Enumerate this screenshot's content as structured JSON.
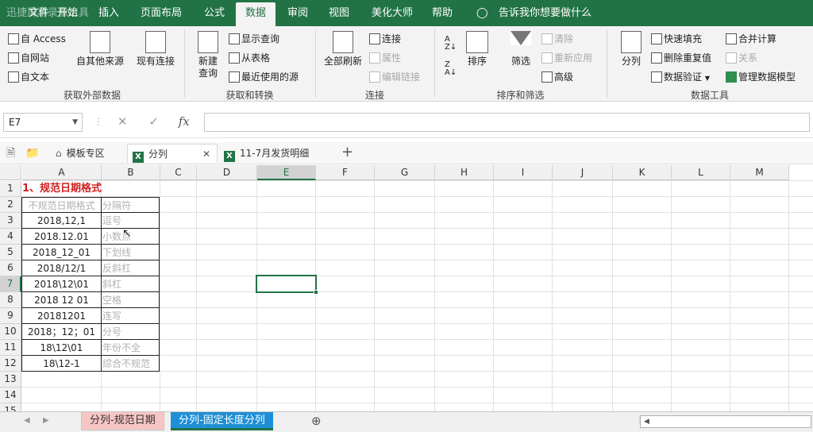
{
  "watermark": "迅捷屏幕录像工具",
  "menu": {
    "items": [
      "文件",
      "开始",
      "插入",
      "页面布局",
      "公式",
      "数据",
      "审阅",
      "视图",
      "美化大师",
      "帮助"
    ],
    "active": "数据",
    "tellme": "告诉我你想要做什么"
  },
  "ribbon": {
    "get_external": {
      "access": "自 Access",
      "web": "自网站",
      "text": "自文本",
      "other": "自其他来源",
      "existing": "现有连接",
      "label": "获取外部数据"
    },
    "get_transform": {
      "new_query": "新建",
      "new_query2": "查询",
      "show_queries": "显示查询",
      "from_table": "从表格",
      "recent_sources": "最近使用的源",
      "label": "获取和转换"
    },
    "connections": {
      "refresh_all": "全部刷新",
      "connections": "连接",
      "properties": "属性",
      "edit_links": "编辑链接",
      "label": "连接"
    },
    "sort_filter": {
      "sort": "排序",
      "filter": "筛选",
      "clear": "清除",
      "reapply": "重新应用",
      "advanced": "高级",
      "label": "排序和筛选"
    },
    "data_tools": {
      "text_to_columns": "分列",
      "flash_fill": "快速填充",
      "remove_dup": "删除重复值",
      "validation": "数据验证",
      "consolidate": "合并计算",
      "relationships": "关系",
      "data_model": "管理数据模型",
      "label": "数据工具"
    }
  },
  "formula_bar": {
    "name_box": "E7",
    "formula": ""
  },
  "doc_tabs": [
    {
      "label": "模板专区"
    },
    {
      "label": "分列"
    },
    {
      "label": "11-7月发货明细"
    }
  ],
  "columns": [
    "A",
    "B",
    "C",
    "D",
    "E",
    "F",
    "G",
    "H",
    "I",
    "J",
    "K",
    "L",
    "M"
  ],
  "rows": [
    "1",
    "2",
    "3",
    "4",
    "5",
    "6",
    "7",
    "8",
    "9",
    "10",
    "11",
    "12",
    "13",
    "14",
    "15"
  ],
  "sheet_title": "1、规范日期格式",
  "table": {
    "header_a": "不规范日期格式",
    "header_b": "分隔符",
    "rows": [
      {
        "a": "2018,12,1",
        "b": "逗号"
      },
      {
        "a": "2018.12.01",
        "b": "小数点"
      },
      {
        "a": "2018_12_01",
        "b": "下划线"
      },
      {
        "a": "2018/12/1",
        "b": "反斜杠"
      },
      {
        "a": "2018\\12\\01",
        "b": "斜杠"
      },
      {
        "a": "2018 12 01",
        "b": "空格"
      },
      {
        "a": "20181201",
        "b": "连写"
      },
      {
        "a": "2018；12；01",
        "b": "分号"
      },
      {
        "a": "18\\12\\01",
        "b": "年份不全"
      },
      {
        "a": "18\\12-1",
        "b": "综合不规范"
      }
    ]
  },
  "selected_cell": "E7",
  "sheets": [
    {
      "label": "分列-规范日期",
      "active": false
    },
    {
      "label": "分列-固定长度分列",
      "active": true
    }
  ],
  "colors": {
    "excel_green": "#217346",
    "title_red": "#d02020",
    "active_sheet_tab": "#1e8fd6",
    "pink_tab": "#f7c5c5"
  }
}
